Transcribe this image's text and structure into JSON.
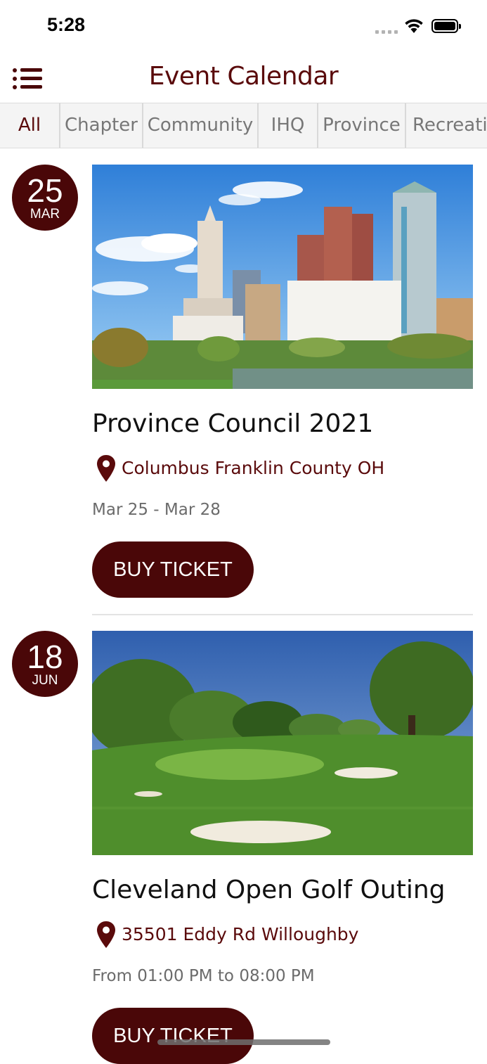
{
  "status_bar": {
    "time": "5:28"
  },
  "header": {
    "title": "Event Calendar"
  },
  "tabs": [
    {
      "label": "All",
      "active": true
    },
    {
      "label": "Chapter",
      "active": false
    },
    {
      "label": "Community",
      "active": false
    },
    {
      "label": "IHQ",
      "active": false
    },
    {
      "label": "Province",
      "active": false
    },
    {
      "label": "Recreational",
      "active": false
    }
  ],
  "events": [
    {
      "day": "25",
      "month": "MAR",
      "title": "Province Council 2021",
      "location": "Columbus Franklin County OH",
      "date_text": "Mar 25 - Mar 28",
      "button_label": "BUY TICKET",
      "image": "city-skyline-photo"
    },
    {
      "day": "18",
      "month": "JUN",
      "title": "Cleveland Open Golf Outing",
      "location": "35501 Eddy Rd Willoughby",
      "date_text": "From 01:00 PM to 08:00 PM",
      "button_label": "BUY TICKET",
      "image": "golf-course-photo"
    }
  ],
  "colors": {
    "brand": "#4a0708",
    "title": "#5a0a0b",
    "tab_bar": "#f4f4f4"
  }
}
